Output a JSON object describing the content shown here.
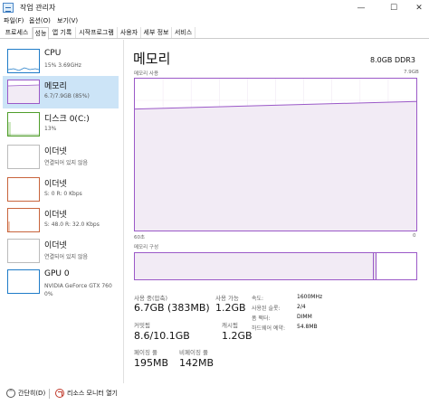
{
  "window": {
    "title": "작업 관리자",
    "min_glyph": "—",
    "max_glyph": "☐",
    "close_glyph": "✕"
  },
  "menu": [
    "파일(F)",
    "옵션(O)",
    "보기(V)"
  ],
  "tabs": [
    "프로세스",
    "성능",
    "앱 기록",
    "시작프로그램",
    "사용자",
    "세부 정보",
    "서비스"
  ],
  "active_tab": "성능",
  "sidebar": {
    "items": [
      {
        "name": "CPU",
        "sub": "15%  3.69GHz",
        "color": "#1f7bc8"
      },
      {
        "name": "메모리",
        "sub": "6.7/7.9GB (85%)",
        "color": "#9b59c8"
      },
      {
        "name": "디스크 0(C:)",
        "sub": "13%",
        "color": "#4f9d2a"
      },
      {
        "name": "이더넷",
        "sub": "연결되어 있지 않음",
        "color": "#999999"
      },
      {
        "name": "이더넷",
        "sub": "S: 0 R: 0 Kbps",
        "color": "#c8643c"
      },
      {
        "name": "이더넷",
        "sub": "S: 48.0  R: 32.0 Kbps",
        "color": "#c8643c"
      },
      {
        "name": "이더넷",
        "sub": "연결되어 있지 않음",
        "color": "#999999"
      },
      {
        "name": "GPU 0",
        "sub": "NVIDIA GeForce GTX 760",
        "sub2": "0%",
        "color": "#1f7bc8"
      }
    ]
  },
  "memory": {
    "title": "메모리",
    "capacity": "8.0GB DDR3",
    "usage_label": "메모리 사용",
    "usage_max": "7.9GB",
    "time_left": "60초",
    "time_right": "0",
    "composition_label": "메모리 구성",
    "usage_fraction_start": 0.8,
    "usage_fraction_end": 0.85,
    "composition_used_fraction": 0.85,
    "stats": {
      "in_use_label": "사용 중(압축)",
      "in_use_value": "6.7GB (383MB)",
      "available_label": "사용 가능",
      "available_value": "1.2GB",
      "committed_label": "커밋됨",
      "committed_value": "8.6/10.1GB",
      "cached_label": "캐시됨",
      "cached_value": "1.2GB",
      "paged_label": "페이징 풀",
      "paged_value": "195MB",
      "nonpaged_label": "비페이징 풀",
      "nonpaged_value": "142MB"
    },
    "specs": {
      "speed_label": "속도:",
      "speed_value": "1600MHz",
      "slots_label": "사용된 슬롯:",
      "slots_value": "2/4",
      "form_label": "폼 팩터:",
      "form_value": "DIMM",
      "reserved_label": "하드웨어 예약:",
      "reserved_value": "54.8MB"
    }
  },
  "footer": {
    "fewer_details": "간단히(D)",
    "resource_monitor": "리소스 모니터 열기"
  }
}
